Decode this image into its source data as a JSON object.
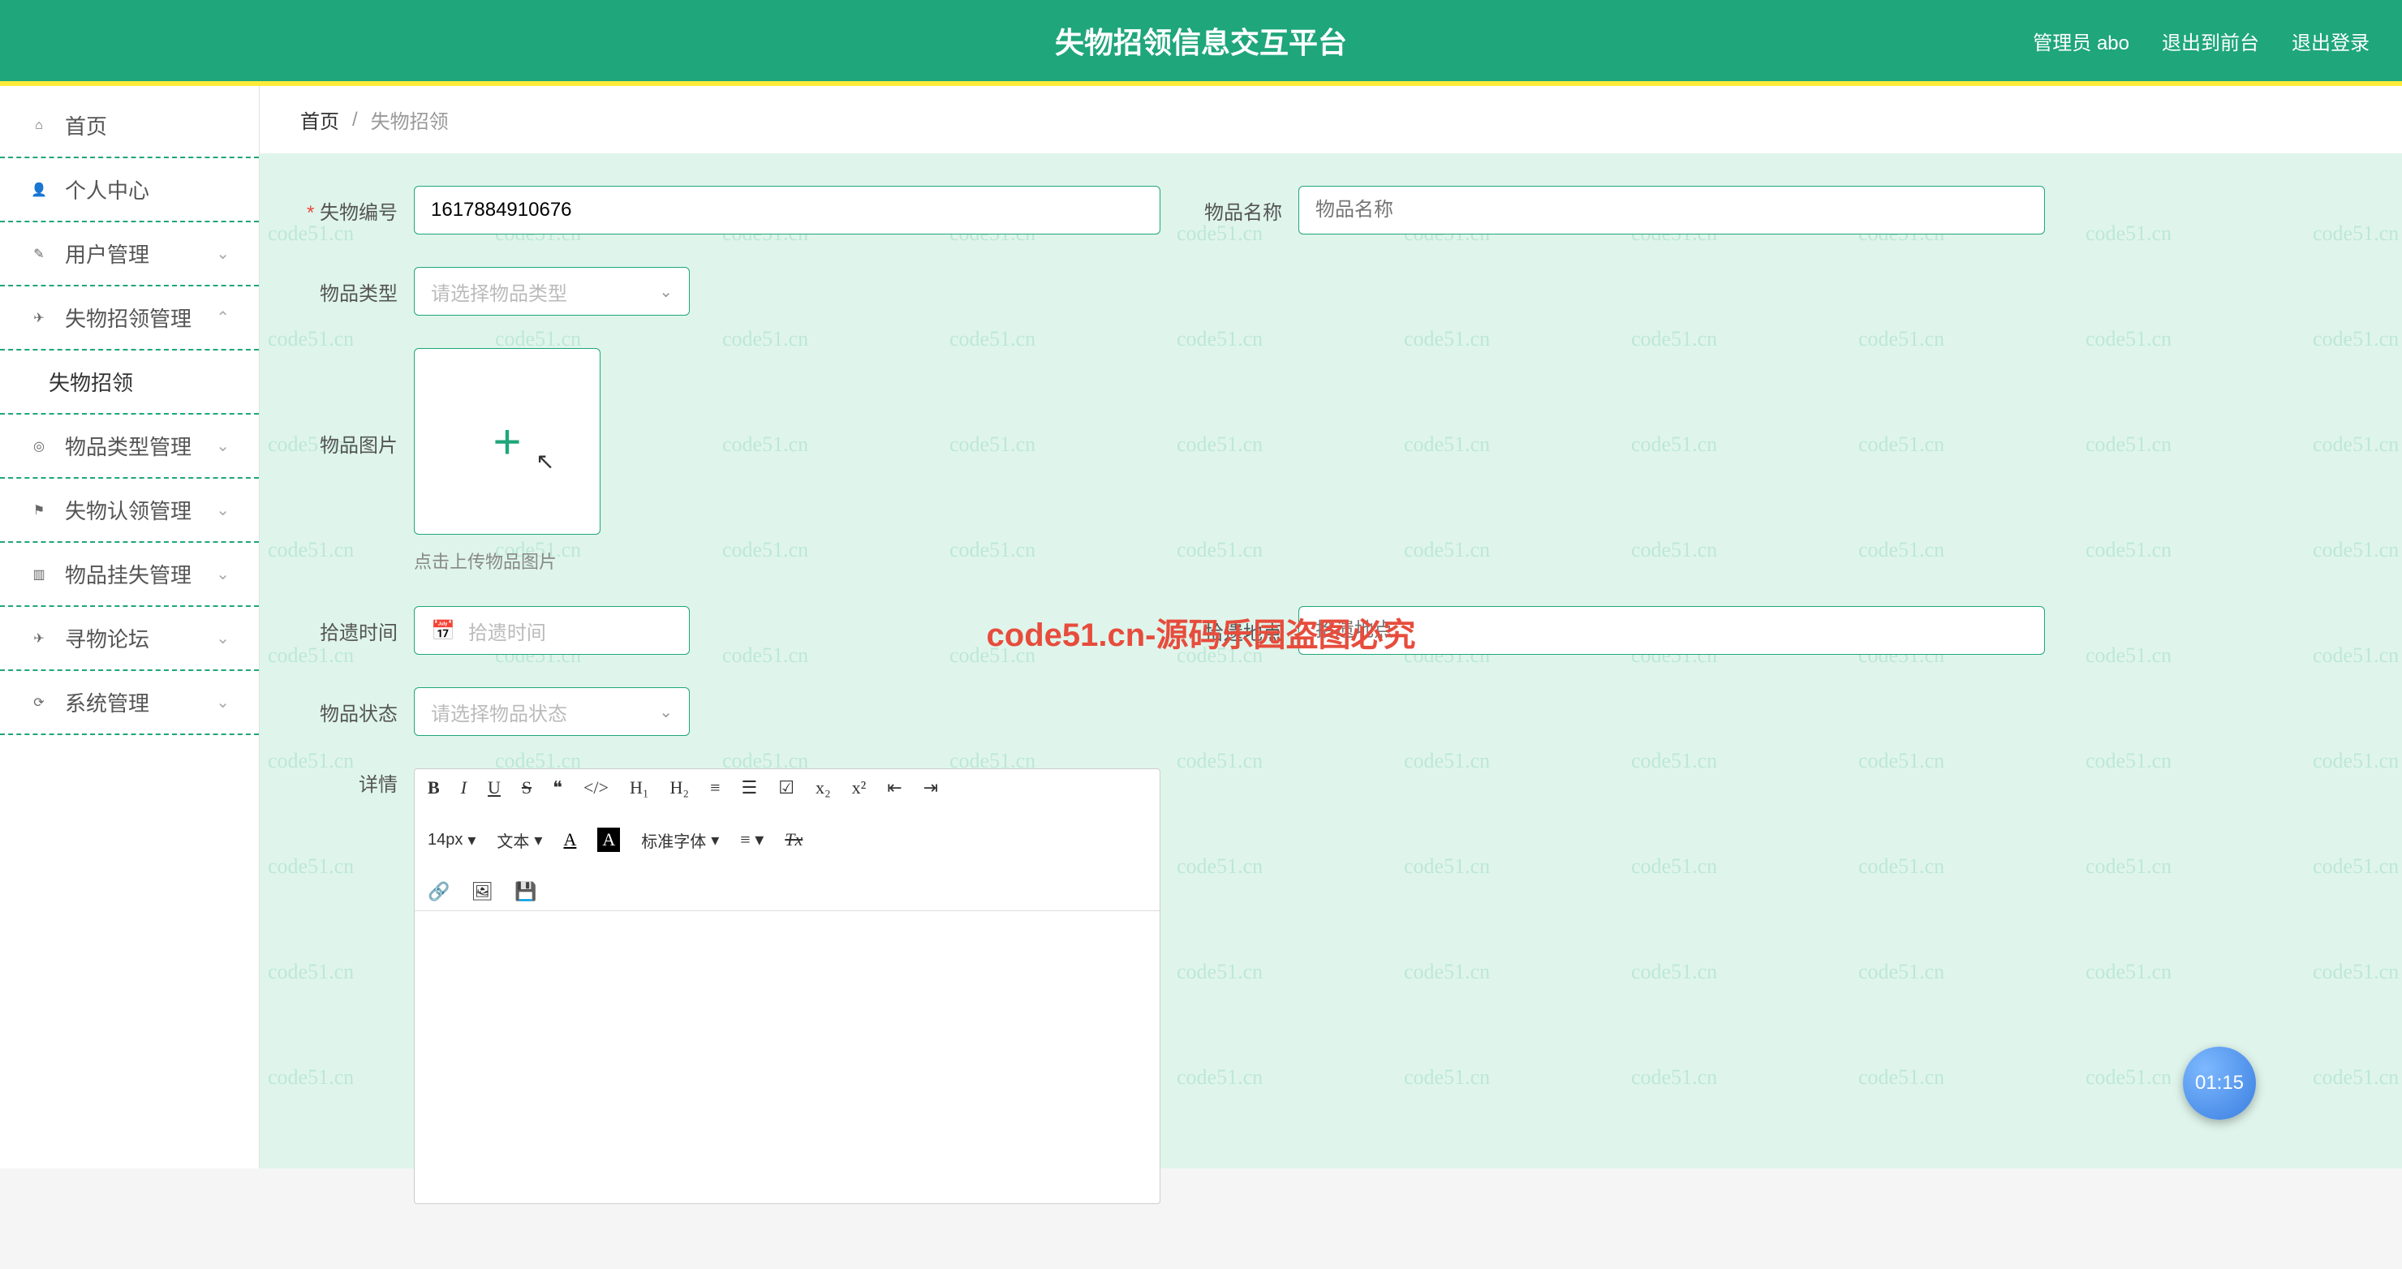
{
  "header": {
    "title": "失物招领信息交互平台",
    "admin": "管理员 abo",
    "exit_front": "退出到前台",
    "exit_login": "退出登录"
  },
  "sidebar": {
    "items": [
      {
        "label": "首页",
        "icon": "home",
        "expandable": false
      },
      {
        "label": "个人中心",
        "icon": "user",
        "expandable": false
      },
      {
        "label": "用户管理",
        "icon": "edit",
        "expandable": true,
        "open": false
      },
      {
        "label": "失物招领管理",
        "icon": "plane",
        "expandable": true,
        "open": true,
        "children": [
          {
            "label": "失物招领"
          }
        ]
      },
      {
        "label": "物品类型管理",
        "icon": "tag",
        "expandable": true,
        "open": false
      },
      {
        "label": "失物认领管理",
        "icon": "flag",
        "expandable": true,
        "open": false
      },
      {
        "label": "物品挂失管理",
        "icon": "chart",
        "expandable": true,
        "open": false
      },
      {
        "label": "寻物论坛",
        "icon": "plane",
        "expandable": true,
        "open": false
      },
      {
        "label": "系统管理",
        "icon": "refresh",
        "expandable": true,
        "open": false
      }
    ]
  },
  "breadcrumb": {
    "home": "首页",
    "sep": "/",
    "cur": "失物招领"
  },
  "form": {
    "id": {
      "label": "失物编号",
      "value": "1617884910676"
    },
    "name": {
      "label": "物品名称",
      "placeholder": "物品名称"
    },
    "type": {
      "label": "物品类型",
      "placeholder": "请选择物品类型"
    },
    "image": {
      "label": "物品图片",
      "hint": "点击上传物品图片"
    },
    "pickup_time": {
      "label": "拾遗时间",
      "placeholder": "拾遗时间"
    },
    "pickup_place": {
      "label": "拾遗地点",
      "placeholder": "拾遗地点"
    },
    "status": {
      "label": "物品状态",
      "placeholder": "请选择物品状态"
    },
    "detail": {
      "label": "详情"
    }
  },
  "editor": {
    "font_size": "14px",
    "heading": "文本",
    "font_family": "标准字体",
    "buttons": [
      "B",
      "I",
      "U",
      "S",
      "❝",
      "❞",
      "H₁",
      "H₂",
      "list-ol",
      "list-ul",
      "tasks",
      "x₂",
      "x²",
      "indent-in",
      "indent-out",
      "A",
      "A-bg",
      "align",
      "clear",
      "link",
      "image",
      "save"
    ]
  },
  "watermark_center": "code51.cn-源码乐园盗图必究",
  "badge_time": "01:15"
}
